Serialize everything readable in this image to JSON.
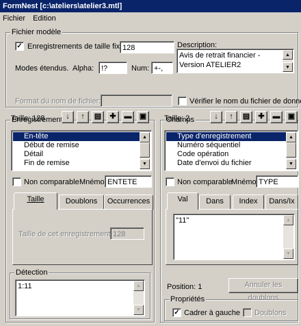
{
  "window": {
    "title": "FormNest [c:\\ateliers\\atelier3.mtl]"
  },
  "menu": {
    "fichier": "Fichier",
    "edition": "Edition"
  },
  "fichier_modele": {
    "legend": "Fichier modèle",
    "fixed_size_checkbox": {
      "label": "Enregistrements de taille fixe:",
      "checked": true
    },
    "fixed_size_value": "128",
    "modes_label": "Modes étendus.",
    "alpha_label": "Alpha:",
    "alpha_value": "!?",
    "num_label": "Num:",
    "num_value": "+-,",
    "format_label": "Format du nom de fichier:",
    "format_value": "",
    "description_label": "Description:",
    "description_value": "Avis de retrait financier - Version ATELIER2",
    "verify_checkbox": {
      "label": "Vérifier le nom du fichier de données",
      "checked": false
    }
  },
  "enregistrements": {
    "legend": "Enregistrements",
    "size_label": "Taille: 128",
    "items": [
      "En-tête",
      "Début de remise",
      "Détail",
      "Fin de remise"
    ],
    "selected_index": 0,
    "non_comparable": {
      "label": "Non comparable",
      "checked": false
    },
    "mnemo_label": "Mnémo:",
    "mnemo_value": "ENTETE",
    "tabs": [
      "Taille",
      "Doublons",
      "Occurrences"
    ],
    "active_tab": 0,
    "record_size_label": "Taille de cet enregistrement:",
    "record_size_value": "128",
    "detection_legend": "Détection",
    "detection_value": "1:11"
  },
  "champs": {
    "legend": "Champs",
    "size_label": "Taille: 2",
    "items": [
      "Type d'enregistrement",
      "Numéro séquentiel",
      "Code opération",
      "Date d'envoi du fichier"
    ],
    "selected_index": 0,
    "non_comparable": {
      "label": "Non comparable",
      "checked": false
    },
    "mnemo_label": "Mnémo:",
    "mnemo_value": "TYPE",
    "tabs": [
      "Val",
      "Dans",
      "Index",
      "Dans/Ix"
    ],
    "active_tab": 0,
    "val_value": "\"11\"",
    "position_label": "Position: 1",
    "cancel_doublons_label": "Annuler les doublons",
    "proprietes_legend": "Propriétés",
    "cadrer_checkbox": {
      "label": "Cadrer à gauche",
      "checked": true
    },
    "doublons_checkbox": {
      "label": "Doublons",
      "checked": false
    }
  },
  "toolbar_icons": [
    "arrow-down-icon",
    "arrow-up-icon",
    "page-icon",
    "add-icon",
    "remove-icon",
    "copy-icon"
  ]
}
